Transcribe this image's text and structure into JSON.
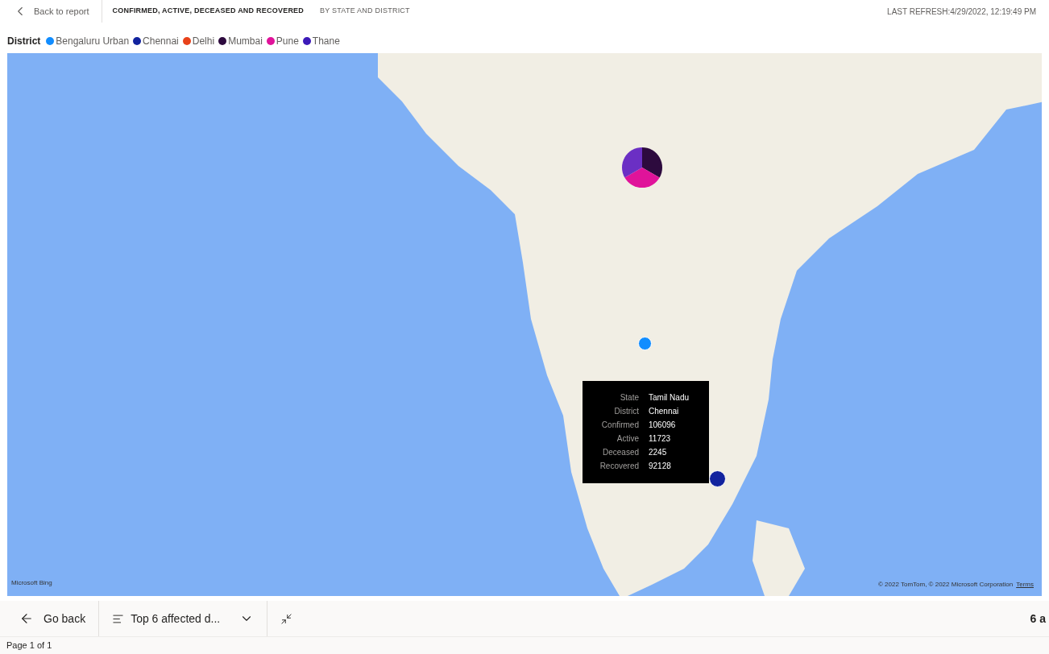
{
  "header": {
    "back": "Back to report",
    "title": "CONFIRMED, ACTIVE, DECEASED AND RECOVERED",
    "subtitle": "BY STATE AND DISTRICT",
    "refresh": "LAST REFRESH:4/29/2022, 12:19:49 PM"
  },
  "legend": {
    "title": "District",
    "items": [
      {
        "label": "Bengaluru Urban",
        "color": "#118dff"
      },
      {
        "label": "Chennai",
        "color": "#12239e"
      },
      {
        "label": "Delhi",
        "color": "#e8421a"
      },
      {
        "label": "Mumbai",
        "color": "#2d0a3e"
      },
      {
        "label": "Pune",
        "color": "#e0139a"
      },
      {
        "label": "Thane",
        "color": "#3c1ab8"
      }
    ]
  },
  "map": {
    "markers": [
      {
        "kind": "pie",
        "slices": [
          {
            "color": "#2d0a3e"
          },
          {
            "color": "#e0139a"
          },
          {
            "color": "#6b2fc4"
          }
        ]
      },
      {
        "kind": "bubble",
        "color": "#118dff"
      },
      {
        "kind": "bubble",
        "color": "#12239e"
      }
    ],
    "logo": "Microsoft Bing",
    "attribution": "© 2022 TomTom, © 2022 Microsoft Corporation",
    "terms": "Terms",
    "tooltip": [
      {
        "label": "State",
        "value": "Tamil Nadu"
      },
      {
        "label": "District",
        "value": "Chennai"
      },
      {
        "label": "Confirmed",
        "value": "106096"
      },
      {
        "label": "Active",
        "value": "11723"
      },
      {
        "label": "Deceased",
        "value": "2245"
      },
      {
        "label": "Recovered",
        "value": "92128"
      }
    ]
  },
  "footer": {
    "go_back": "Go back",
    "bookmark": "Top 6 affected d...",
    "right": "6 a",
    "page": "Page 1 of 1"
  }
}
